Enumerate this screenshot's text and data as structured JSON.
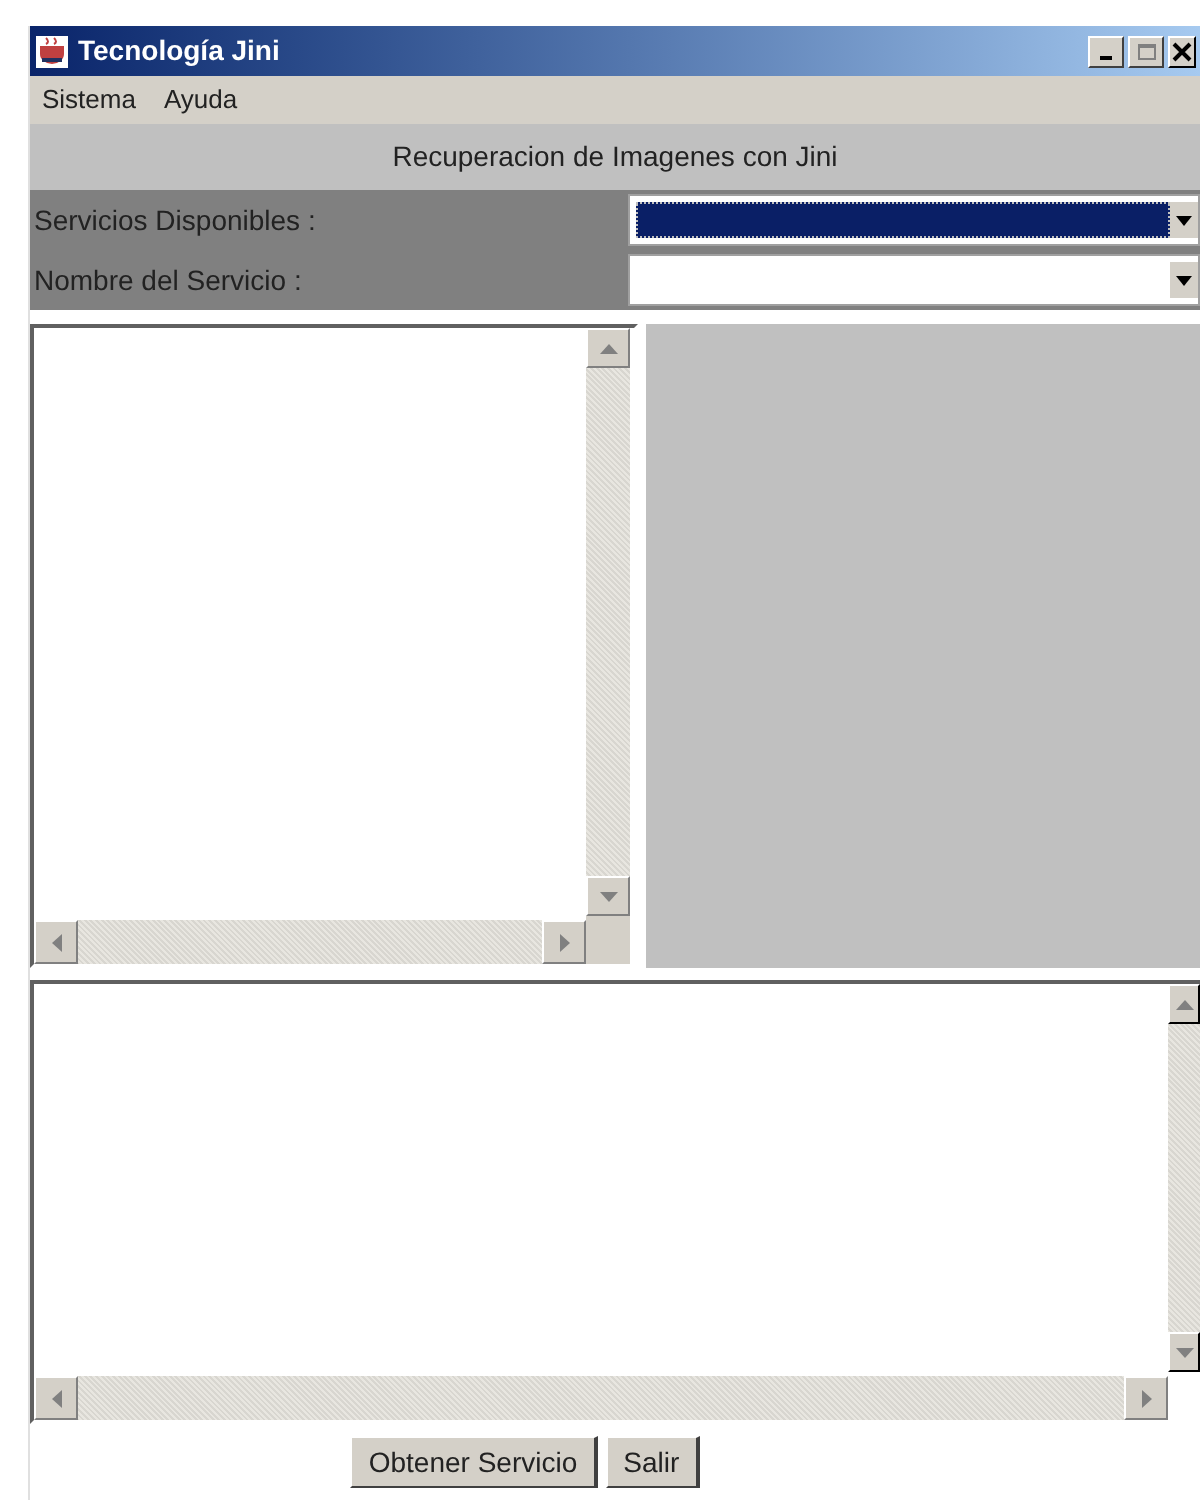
{
  "window": {
    "title": "Tecnología Jini"
  },
  "menu": [
    "Sistema",
    "Ayuda"
  ],
  "header": "Recuperacion de Imagenes con Jini",
  "fields": [
    {
      "label": "Servicios Disponibles :",
      "selected": true
    },
    {
      "label": "Nombre del Servicio :",
      "selected": false
    }
  ],
  "buttons": [
    "Obtener Servicio",
    "Salir"
  ]
}
